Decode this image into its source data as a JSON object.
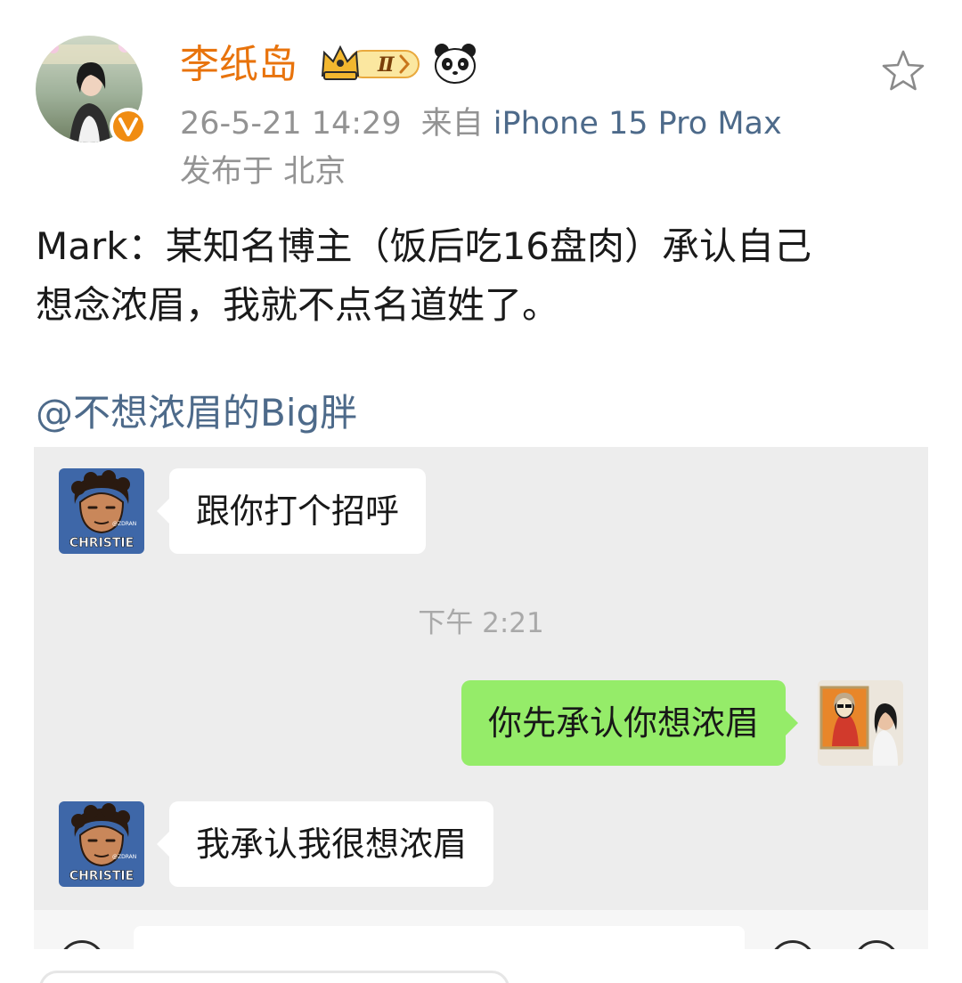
{
  "post": {
    "username": "李纸岛",
    "vip_level": "Ⅱ",
    "timestamp": "26-5-21 14:29",
    "source_prefix": "来自",
    "device": "iPhone 15 Pro Max",
    "location_prefix": "发布于",
    "location": "北京",
    "body_lines": [
      "Mark：某知名博主（饭后吃16盘肉）承认自己",
      "想念浓眉，我就不点名道姓了。"
    ],
    "mention": "@不想浓眉的Big胖"
  },
  "chat": {
    "avatar_label": "CHRISTIE",
    "avatar_small": "@ZDRAN",
    "messages": [
      {
        "side": "left",
        "text": "跟你打个招呼"
      },
      {
        "side": "right",
        "text": "你先承认你想浓眉"
      },
      {
        "side": "left",
        "text": "我承认我很想浓眉"
      }
    ],
    "time_divider": "下午 2:21"
  },
  "colors": {
    "username": "#e8730c",
    "link": "#4d6a8a",
    "meta": "#939393",
    "bubble_right": "#95ec69",
    "chat_bg": "#ededed"
  },
  "icons": [
    "star-icon",
    "verified-v-icon",
    "crown-vip-icon",
    "panda-icon"
  ]
}
